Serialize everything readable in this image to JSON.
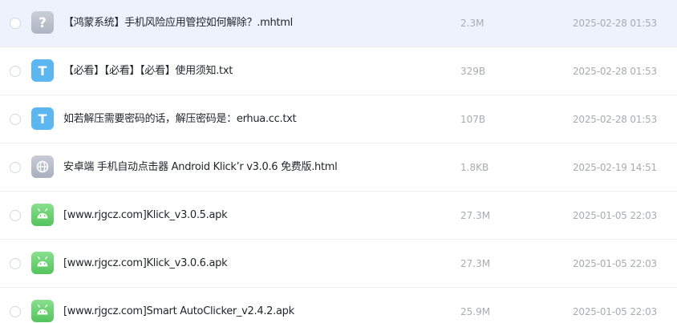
{
  "files": [
    {
      "name": "【鸿蒙系统】手机风险应用管控如何解除？.mhtml",
      "size": "2.3M",
      "date": "2025-02-28 01:53",
      "icon": "unknown-file-icon",
      "selected": true
    },
    {
      "name": "【必看】【必看】【必看】使用须知.txt",
      "size": "329B",
      "date": "2025-02-28 01:53",
      "icon": "txt-file-icon",
      "selected": false
    },
    {
      "name": "如若解压需要密码的话，解压密码是：erhua.cc.txt",
      "size": "107B",
      "date": "2025-02-28 01:53",
      "icon": "txt-file-icon",
      "selected": false
    },
    {
      "name": "安卓端 手机自动点击器 Android Klick’r v3.0.6 免费版.html",
      "size": "1.8KB",
      "date": "2025-02-19 14:51",
      "icon": "html-file-icon",
      "selected": false
    },
    {
      "name": "[www.rjgcz.com]Klick_v3.0.5.apk",
      "size": "27.3M",
      "date": "2025-01-05 22:03",
      "icon": "apk-file-icon",
      "selected": false
    },
    {
      "name": "[www.rjgcz.com]Klick_v3.0.6.apk",
      "size": "27.3M",
      "date": "2025-01-05 22:03",
      "icon": "apk-file-icon",
      "selected": false
    },
    {
      "name": "[www.rjgcz.com]Smart AutoClicker_v2.4.2.apk",
      "size": "25.9M",
      "date": "2025-01-05 22:03",
      "icon": "apk-file-icon",
      "selected": false
    }
  ],
  "icon_text": {
    "unknown": "?",
    "txt": "T"
  },
  "colors": {
    "selected_row": "#eef2fd",
    "txt_icon": "#5cb7f0",
    "apk_icon": "#52c45b",
    "muted_text": "#a8abb2"
  }
}
